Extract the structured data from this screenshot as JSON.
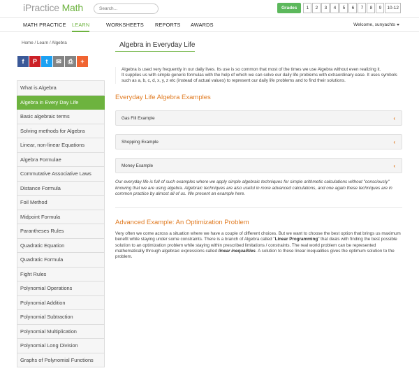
{
  "header": {
    "logo_prefix": "iPractice ",
    "logo_suffix": "Math",
    "search_placeholder": "Search...",
    "grades_label": "Grades",
    "grades": [
      "1",
      "2",
      "3",
      "4",
      "5",
      "6",
      "7",
      "8",
      "9",
      "10-12"
    ]
  },
  "nav": {
    "items": [
      "MATH PRACTICE",
      "LEARN",
      "WORKSHEETS",
      "REPORTS",
      "AWARDS"
    ],
    "active": "LEARN",
    "welcome": "Welcome, sunyachts"
  },
  "breadcrumb": "Home  /  Learn  /  Algebra",
  "share_icons": [
    "facebook-icon",
    "pinterest-icon",
    "twitter-icon",
    "email-icon",
    "print-icon",
    "plus-icon"
  ],
  "sidebar": {
    "items": [
      "What is Algebra",
      "Algebra in Every Day Life",
      "Basic algebraic terms",
      "Solving methods for Algebra",
      "Linear, non-linear Equations",
      "Algebra Formulae",
      "Commutative Associative Laws",
      "Distance Formula",
      "Foil Method",
      "Midpoint Formula",
      "Parantheses Rules",
      "Quadratic Equation",
      "Quadratic Formula",
      "Fight Rules",
      "Polynomial Operations",
      "Polynomial Addition",
      "Polynomial Subtraction",
      "Polynomial Multiplication",
      "Polynomial Long Division",
      "Graphs of Polynomial Functions"
    ],
    "active_index": 1
  },
  "main": {
    "title": "Algebra in Everyday Life",
    "intro_1": "Algebra is used very frequently in our daily lives. Its use is so common that most of the times we use Algebra without even realizing it.",
    "intro_2": "It supplies us with simple generic formulas with the help of which we can solve our daily life problems with extraordinary ease. It uses symbols such as a, b, c, d, x, y, z etc (instead of actual values) to represent our daily life problems and to find their solutions.",
    "examples_title": "Everyday Life Algebra Examples",
    "examples": [
      "Gas Fill Example",
      "Shopping Example",
      "Money Example"
    ],
    "italic_text": "Our everyday life is full of such examples where we apply simple algebraic techniques for simple arithmetic calculations without \"consciously\" knowing that we are using algebra. Algebraic techniques are also useful in more advanced calculations, and one again these techniques are in common practice by almost all of us. We present an example here.",
    "advanced_title": "Advanced Example: An Optimization Problem",
    "adv_1": "Very often we come across a situation where we have a couple of different choices. But we want to choose the best option that brings us maximum benefit while staying under some constraints. There is a branch of Algebra called \"",
    "adv_bold_1": "Linear Programming",
    "adv_2": "\" that deals with finding the best possible solution to an optimization problem while staying within prescribed limitations / constraints. The real world problem can be represented mathematically through algebraic expressions called ",
    "adv_bold_2": "linear inequalities",
    "adv_3": ". A solution to these linear inequalities gives the optimum solution to the problem."
  },
  "colors": {
    "accent_green": "#6db33f",
    "accent_orange": "#e07b22"
  }
}
